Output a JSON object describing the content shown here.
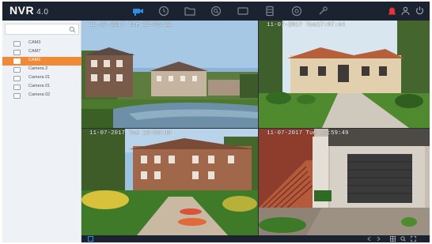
{
  "app": {
    "brand": "NVR",
    "version": "4.0",
    "accent_color": "#ef8b37",
    "topbar_color": "#1b2330",
    "active_nav_color": "#2d8ee5"
  },
  "topnav": {
    "items": [
      {
        "name": "live-view",
        "icon": "camera-icon",
        "active": true
      },
      {
        "name": "playback",
        "icon": "playback-icon"
      },
      {
        "name": "file-management",
        "icon": "folder-icon"
      },
      {
        "name": "smart-analysis",
        "icon": "search-analysis-icon"
      },
      {
        "name": "video-wall",
        "icon": "monitor-icon"
      },
      {
        "name": "storage",
        "icon": "database-icon"
      },
      {
        "name": "system",
        "icon": "settings-icon"
      },
      {
        "name": "maintenance",
        "icon": "wrench-icon"
      }
    ],
    "right": [
      {
        "name": "alarm",
        "icon": "alarm-icon",
        "color": "#e0333a"
      },
      {
        "name": "account",
        "icon": "user-icon"
      },
      {
        "name": "power",
        "icon": "power-icon"
      }
    ]
  },
  "sidebar": {
    "search_placeholder": "",
    "cameras": [
      {
        "label": "CAM3",
        "selected": false
      },
      {
        "label": "CAM7",
        "selected": false
      },
      {
        "label": "CAM3",
        "selected": true
      },
      {
        "label": "Camera 2",
        "selected": false
      },
      {
        "label": "Camera 01",
        "selected": false
      },
      {
        "label": "Camera 01",
        "selected": false
      },
      {
        "label": "Camera 02",
        "selected": false
      }
    ]
  },
  "views": [
    {
      "osd": "11-07-2017 Tue 17:06:22",
      "scene": "townhouses-lake"
    },
    {
      "osd": "11-07-2017 Tue17:07:44",
      "scene": "villa-lawn"
    },
    {
      "osd": "11-07-2017 Tue 16:59:49",
      "scene": "mansion-garden"
    },
    {
      "osd": "11-07-2017 Tue 16:59:49",
      "scene": "garage-stairs"
    }
  ],
  "bottombar": {
    "left_icon": "layout-icon",
    "right_icons": [
      "prev-page-icon",
      "next-page-icon",
      "grid-layout-icon",
      "zoom-icon",
      "fullscreen-icon"
    ]
  }
}
